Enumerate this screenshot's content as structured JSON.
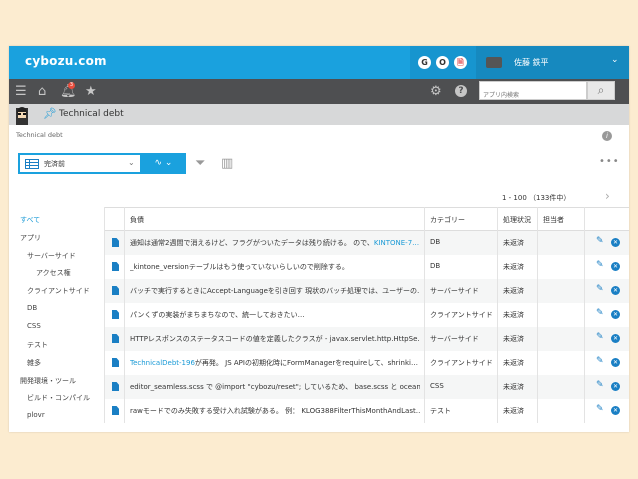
{
  "header": {
    "logo": "cybozu.com",
    "apps": [
      "G",
      "O",
      "🗎"
    ],
    "user_name": "佐藤 鉄平"
  },
  "navbar": {
    "notification_count": "3",
    "search_placeholder": "アプリ内検索"
  },
  "app": {
    "title": "Technical debt",
    "breadcrumb": "Technical debt"
  },
  "toolbar": {
    "view_name": "完済前",
    "pagination": "1 - 100 （133件中）"
  },
  "sidebar": {
    "items": [
      {
        "label": "すべて"
      },
      {
        "label": "アプリ"
      },
      {
        "label": "サーバーサイド"
      },
      {
        "label": "アクセス権"
      },
      {
        "label": "クライアントサイド"
      },
      {
        "label": "DB"
      },
      {
        "label": "CSS"
      },
      {
        "label": "テスト"
      },
      {
        "label": "雑多"
      },
      {
        "label": "開発環境・ツール"
      },
      {
        "label": "ビルド・コンパイル"
      },
      {
        "label": "plovr"
      }
    ]
  },
  "table": {
    "columns": [
      "負債",
      "カテゴリー",
      "処理状況",
      "担当者"
    ],
    "rows": [
      {
        "debt_pre": "通知は通常2週間で消えるけど、フラグがついたデータは残り続ける。 ので、",
        "debt_link": "KINTONE-7…",
        "debt_post": "",
        "category": "DB",
        "status": "未返済"
      },
      {
        "debt_pre": "_kintone_versionテーブルはもう使っていないらしいので削除する。",
        "debt_link": "",
        "debt_post": "",
        "category": "DB",
        "status": "未返済"
      },
      {
        "debt_pre": "バッチで実行するときにAccept-Languageを引き回す 現状のバッチ処理では、ユーザーの…",
        "debt_link": "",
        "debt_post": "",
        "category": "サーバーサイド",
        "status": "未返済"
      },
      {
        "debt_pre": "パンくずの実装がまちまちなので、統一しておきたい…",
        "debt_link": "",
        "debt_post": "",
        "category": "クライアントサイド",
        "status": "未返済"
      },
      {
        "debt_pre": "HTTPレスポンスのステータスコードの値を定義したクラスが - javax.servlet.http.HttpSe…",
        "debt_link": "",
        "debt_post": "",
        "category": "サーバーサイド",
        "status": "未返済"
      },
      {
        "debt_pre": "",
        "debt_link": "TechnicalDebt-196",
        "debt_post": "が再発。 JS APIの初期化時にFormManagerをrequireして、shrinki…",
        "category": "クライアントサイド",
        "status": "未返済"
      },
      {
        "debt_pre": "editor_seamless.scss で @import \"cybozu/reset\"; しているため、 base.scss と ocean…",
        "debt_link": "",
        "debt_post": "",
        "category": "CSS",
        "status": "未返済"
      },
      {
        "debt_pre": "rawモードでのみ失敗する受け入れ試験がある。 例： KLOG388FilterThisMonthAndLast…",
        "debt_link": "",
        "debt_post": "",
        "category": "テスト",
        "status": "未返済"
      }
    ]
  },
  "colors": {
    "brand": "#1aa1de",
    "nav": "#4e4f51",
    "link": "#1a9ad6",
    "background": "#fcecd0"
  }
}
